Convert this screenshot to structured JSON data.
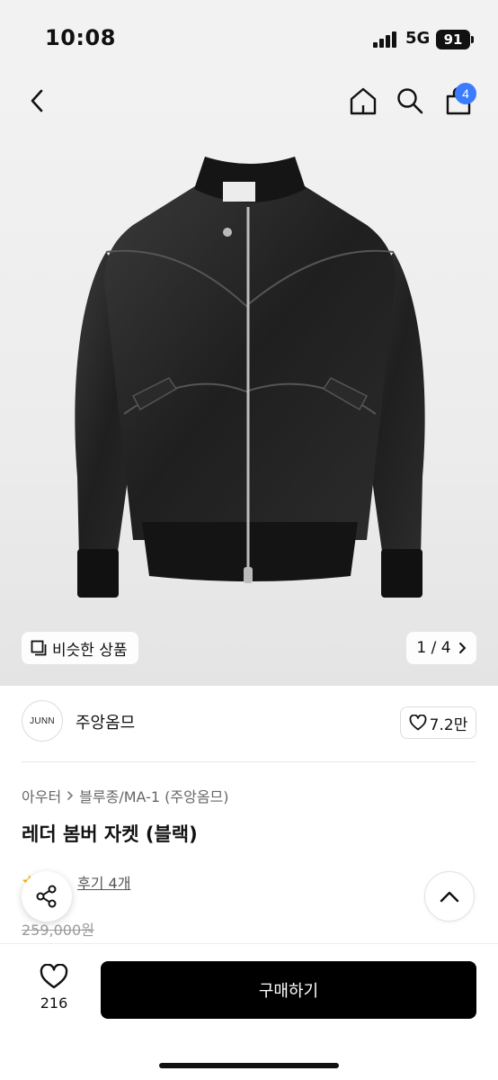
{
  "status_bar": {
    "time": "10:08",
    "network": "5G",
    "battery": "91"
  },
  "header": {
    "cart_count": "4"
  },
  "image": {
    "similar_label": "비슷한 상품",
    "page_indicator": "1 / 4"
  },
  "brand": {
    "logo_text": "JUNN",
    "name": "주앙옴므",
    "likes": "7.2만"
  },
  "breadcrumb": {
    "category": "아우터",
    "subcategory": "블루종/MA-1 (주앙옴므)"
  },
  "product": {
    "title": "레더 봄버 자켓 (블랙)",
    "review_text": "후기 4개",
    "original_price": "259,000원"
  },
  "bottom": {
    "wish_count": "216",
    "buy_label": "구매하기"
  },
  "colors": {
    "accent": "#3b7cff",
    "buy_button": "#000000"
  },
  "icons": [
    "back-icon",
    "home-icon",
    "search-icon",
    "cart-icon",
    "similar-icon",
    "chevron-right-icon",
    "heart-icon",
    "star-icon",
    "share-icon",
    "chevron-up-icon"
  ]
}
